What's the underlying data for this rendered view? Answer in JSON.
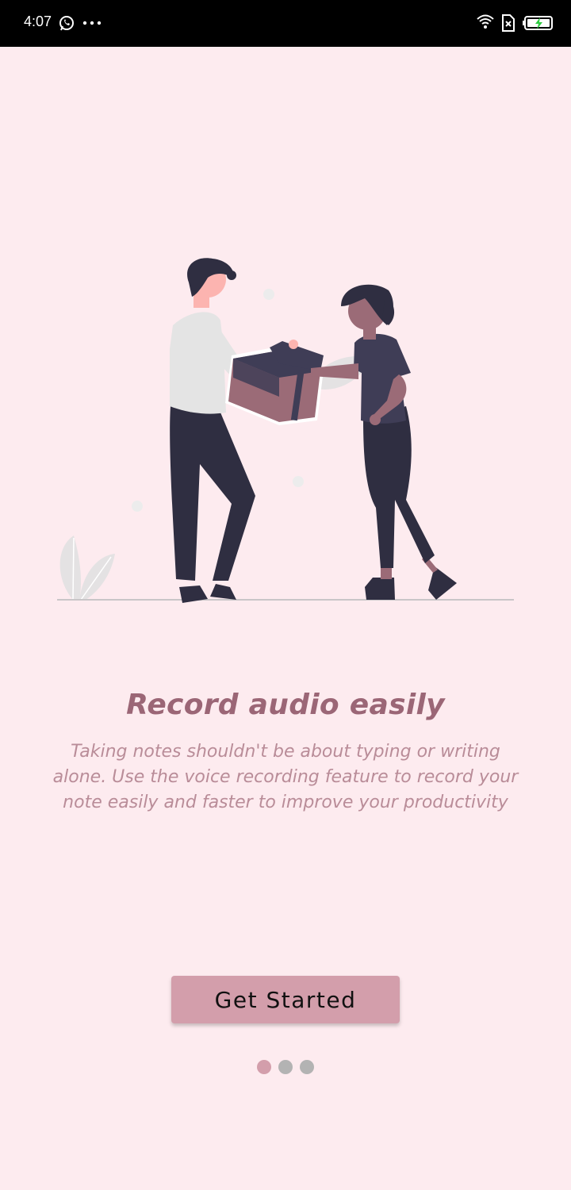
{
  "status_bar": {
    "time": "4:07",
    "left_icons": [
      "whatsapp-icon",
      "more-dots-icon"
    ],
    "right_icons": [
      "wifi-icon",
      "sim-off-icon",
      "battery-charging-icon"
    ]
  },
  "onboarding": {
    "title": "Record audio easily",
    "description": "Taking notes shouldn't be about typing or writing alone. Use the voice recording feature to record your note easily and faster to improve your productivity",
    "button_label": "Get Started",
    "page_indicator": {
      "total": 3,
      "active_index": 0
    }
  },
  "colors": {
    "background": "#fdebef",
    "title": "#9b6676",
    "description": "#b98c98",
    "button": "#d39eab",
    "dot_active": "#d39eab",
    "dot_inactive": "#b3b3b3"
  }
}
